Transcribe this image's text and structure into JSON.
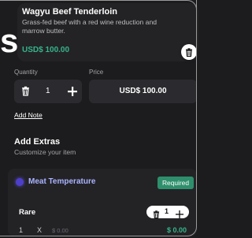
{
  "page_heading_fragment": "s",
  "item": {
    "name": "Wagyu Beef Tenderloin",
    "description": "Grass-fed beef with a red wine reduction and marrow butter.",
    "price": "USD$ 100.00"
  },
  "order": {
    "quantity_label": "Quantity",
    "price_label": "Price",
    "quantity": "1",
    "price": "USD$ 100.00",
    "add_note": "Add Note"
  },
  "extras": {
    "title": "Add Extras",
    "subtitle": "Customize your item",
    "groups": [
      {
        "title": "Meat Temperature",
        "badge": "Required",
        "options": [
          {
            "name": "Rare",
            "qty": "1",
            "x": "X",
            "unit_price": "$ 0.00",
            "selected_qty": "1",
            "total": "$ 0.00"
          }
        ]
      }
    ]
  },
  "colors": {
    "accent_green": "#36b48a",
    "badge_green": "#2e8f6c",
    "group_title": "#aab4ff",
    "dot": "#4d3fc9"
  },
  "icons": [
    "trash-icon",
    "plus-icon"
  ]
}
